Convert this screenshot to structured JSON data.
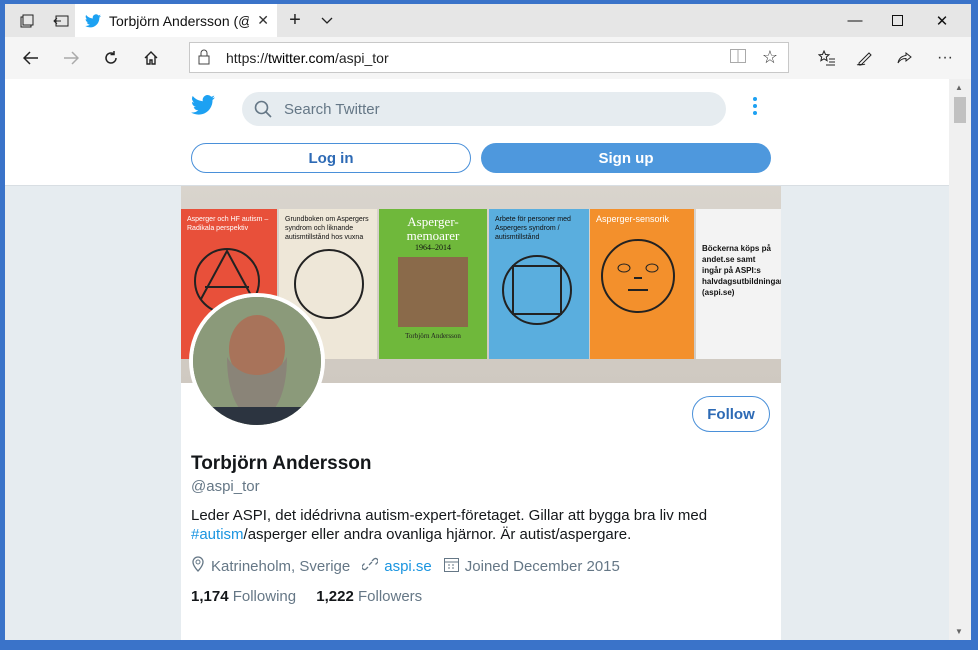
{
  "browser": {
    "tab_title": "Torbjörn Andersson (@a",
    "url_prefix": "https://",
    "url_host": "twitter.com",
    "url_path": "/aspi_tor"
  },
  "twitter": {
    "search_placeholder": "Search Twitter",
    "login_label": "Log in",
    "signup_label": "Sign up",
    "follow_label": "Follow"
  },
  "banner": {
    "book1": "Asperger och HF autism – Radikala perspektiv",
    "book2": "Grundboken om Aspergers syndrom och liknande autismtillstånd hos vuxna",
    "book3_title": "Asperger-memoarer",
    "book3_years": "1964–2014",
    "book3_author": "Torbjörn Andersson",
    "book4": "Arbete för personer med Aspergers syndrom / autismtillstånd",
    "book5": "Asperger-sensorik",
    "note": "Böckerna köps på andet.se samt ingår på ASPI:s halvdagsutbildningar (aspi.se)"
  },
  "profile": {
    "name": "Torbjörn Andersson",
    "handle": "@aspi_tor",
    "bio_before": "Leder ASPI, det idédrivna autism-expert-företaget. Gillar att bygga bra liv med ",
    "bio_hashtag": "#autism",
    "bio_after": "/asperger eller andra ovanliga hjärnor. Är autist/aspergare.",
    "location": "Katrineholm, Sverige",
    "website": "aspi.se",
    "joined": "Joined December 2015",
    "following_count": "1,174",
    "following_label": "Following",
    "followers_count": "1,222",
    "followers_label": "Followers"
  },
  "colors": {
    "accent": "#1da1f2",
    "signup_bg": "#4e98dd",
    "frame": "#3a73c9"
  }
}
